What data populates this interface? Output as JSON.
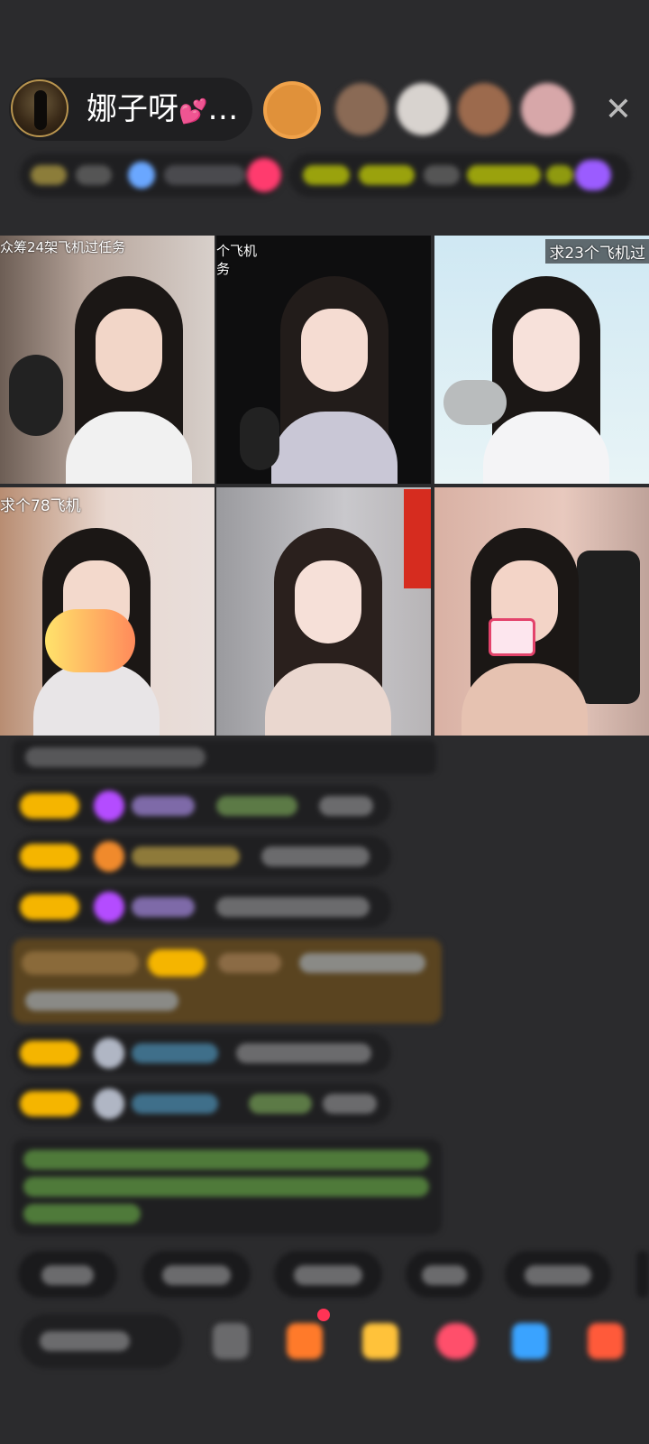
{
  "header": {
    "host_name": "娜子呀",
    "host_name_suffix": "…"
  },
  "icons": {
    "heart": "💕",
    "close": "✕"
  },
  "tiles": [
    {
      "caption": "众筹24架飞机过任务"
    },
    {
      "caption": "个飞机",
      "caption_line2": "务"
    },
    {
      "caption": "求23个飞机过"
    },
    {
      "caption": "求个78飞机"
    },
    {
      "caption": ""
    },
    {
      "caption": ""
    }
  ],
  "colors": {
    "background": "#2b2b2d",
    "badge_gold": "#f5b500",
    "gem_purple": "#b44cff",
    "accent_pink": "#ff4fa3"
  }
}
